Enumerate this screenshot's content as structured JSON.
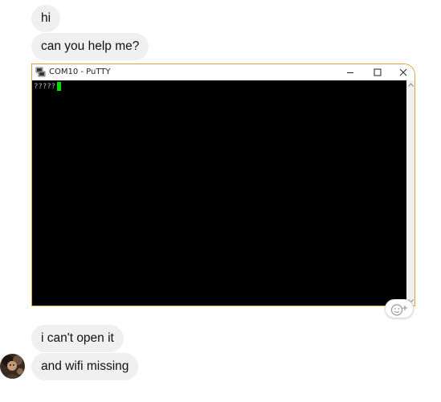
{
  "messages": [
    {
      "text": "hi"
    },
    {
      "text": "can you help me?"
    },
    {
      "text": "i can't open it"
    },
    {
      "text": "and wifi missing"
    }
  ],
  "attachment": {
    "window_title": "COM10 - PuTTY",
    "terminal_output": "?????",
    "colors": {
      "terminal_bg": "#000000",
      "cursor": "#00e000",
      "border": "#d9a441"
    }
  },
  "icons": {
    "app": "putty-icon",
    "minimize": "minimize-icon",
    "maximize": "maximize-icon",
    "close": "close-icon",
    "reaction": "smiley-plus-icon",
    "avatar": "user-avatar"
  },
  "colors": {
    "bubble_bg": "#f1f0f0",
    "bubble_text": "#111111"
  }
}
